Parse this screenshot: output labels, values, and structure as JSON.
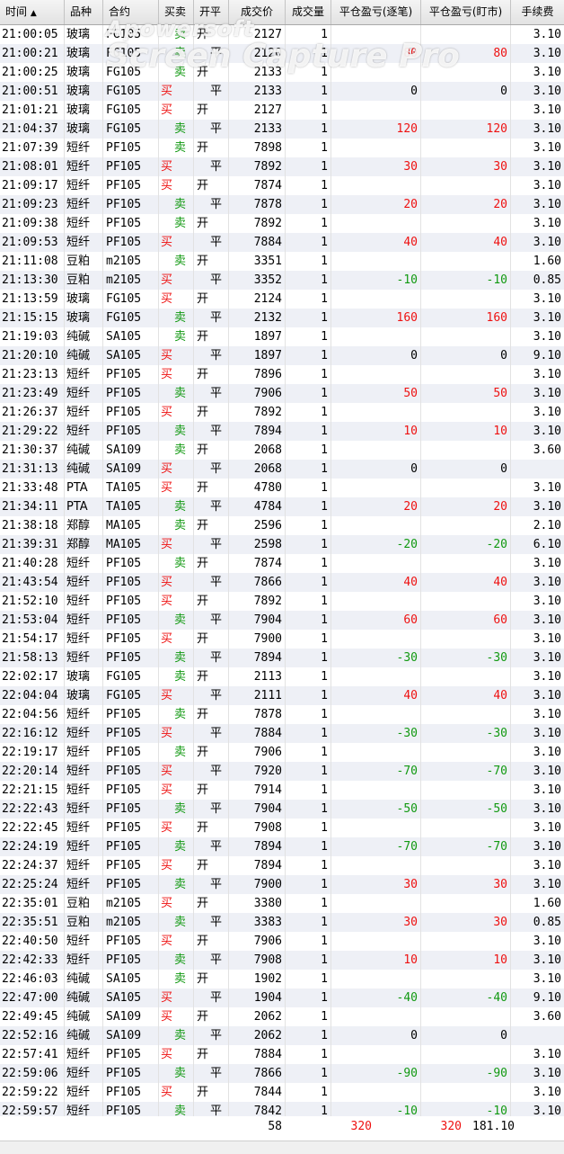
{
  "headers": {
    "time": "时间",
    "sort_arrow": "▲",
    "name": "品种",
    "code": "合约",
    "bs": "买卖",
    "oc": "开平",
    "price": "成交价",
    "qty": "成交量",
    "pl_close": "平仓盈亏(逐笔)",
    "pl_mark": "平仓盈亏(盯市)",
    "fee": "手续费"
  },
  "rows": [
    {
      "time": "21:00:05",
      "name": "玻璃",
      "code": "FG105",
      "bs": "卖",
      "oc": "开",
      "price": "2127",
      "qty": "1",
      "pl1": "",
      "pl2": "",
      "fee": "3.10"
    },
    {
      "time": "21:00:21",
      "name": "玻璃",
      "code": "FG105",
      "bs": "卖",
      "oc": "平",
      "price": "2120",
      "qty": "1",
      "pl1": "80",
      "pl2": "80",
      "fee": "3.10"
    },
    {
      "time": "21:00:25",
      "name": "玻璃",
      "code": "FG105",
      "bs": "卖",
      "oc": "开",
      "price": "2133",
      "qty": "1",
      "pl1": "",
      "pl2": "",
      "fee": "3.10"
    },
    {
      "time": "21:00:51",
      "name": "玻璃",
      "code": "FG105",
      "bs": "买",
      "oc": "平",
      "price": "2133",
      "qty": "1",
      "pl1": "0",
      "pl2": "0",
      "fee": "3.10"
    },
    {
      "time": "21:01:21",
      "name": "玻璃",
      "code": "FG105",
      "bs": "买",
      "oc": "开",
      "price": "2127",
      "qty": "1",
      "pl1": "",
      "pl2": "",
      "fee": "3.10"
    },
    {
      "time": "21:04:37",
      "name": "玻璃",
      "code": "FG105",
      "bs": "卖",
      "oc": "平",
      "price": "2133",
      "qty": "1",
      "pl1": "120",
      "pl2": "120",
      "fee": "3.10"
    },
    {
      "time": "21:07:39",
      "name": "短纤",
      "code": "PF105",
      "bs": "卖",
      "oc": "开",
      "price": "7898",
      "qty": "1",
      "pl1": "",
      "pl2": "",
      "fee": "3.10"
    },
    {
      "time": "21:08:01",
      "name": "短纤",
      "code": "PF105",
      "bs": "买",
      "oc": "平",
      "price": "7892",
      "qty": "1",
      "pl1": "30",
      "pl2": "30",
      "fee": "3.10"
    },
    {
      "time": "21:09:17",
      "name": "短纤",
      "code": "PF105",
      "bs": "买",
      "oc": "开",
      "price": "7874",
      "qty": "1",
      "pl1": "",
      "pl2": "",
      "fee": "3.10"
    },
    {
      "time": "21:09:23",
      "name": "短纤",
      "code": "PF105",
      "bs": "卖",
      "oc": "平",
      "price": "7878",
      "qty": "1",
      "pl1": "20",
      "pl2": "20",
      "fee": "3.10"
    },
    {
      "time": "21:09:38",
      "name": "短纤",
      "code": "PF105",
      "bs": "卖",
      "oc": "开",
      "price": "7892",
      "qty": "1",
      "pl1": "",
      "pl2": "",
      "fee": "3.10"
    },
    {
      "time": "21:09:53",
      "name": "短纤",
      "code": "PF105",
      "bs": "买",
      "oc": "平",
      "price": "7884",
      "qty": "1",
      "pl1": "40",
      "pl2": "40",
      "fee": "3.10"
    },
    {
      "time": "21:11:08",
      "name": "豆粕",
      "code": "m2105",
      "bs": "卖",
      "oc": "开",
      "price": "3351",
      "qty": "1",
      "pl1": "",
      "pl2": "",
      "fee": "1.60"
    },
    {
      "time": "21:13:30",
      "name": "豆粕",
      "code": "m2105",
      "bs": "买",
      "oc": "平",
      "price": "3352",
      "qty": "1",
      "pl1": "-10",
      "pl2": "-10",
      "fee": "0.85"
    },
    {
      "time": "21:13:59",
      "name": "玻璃",
      "code": "FG105",
      "bs": "买",
      "oc": "开",
      "price": "2124",
      "qty": "1",
      "pl1": "",
      "pl2": "",
      "fee": "3.10"
    },
    {
      "time": "21:15:15",
      "name": "玻璃",
      "code": "FG105",
      "bs": "卖",
      "oc": "平",
      "price": "2132",
      "qty": "1",
      "pl1": "160",
      "pl2": "160",
      "fee": "3.10"
    },
    {
      "time": "21:19:03",
      "name": "纯碱",
      "code": "SA105",
      "bs": "卖",
      "oc": "开",
      "price": "1897",
      "qty": "1",
      "pl1": "",
      "pl2": "",
      "fee": "3.10"
    },
    {
      "time": "21:20:10",
      "name": "纯碱",
      "code": "SA105",
      "bs": "买",
      "oc": "平",
      "price": "1897",
      "qty": "1",
      "pl1": "0",
      "pl2": "0",
      "fee": "9.10"
    },
    {
      "time": "21:23:13",
      "name": "短纤",
      "code": "PF105",
      "bs": "买",
      "oc": "开",
      "price": "7896",
      "qty": "1",
      "pl1": "",
      "pl2": "",
      "fee": "3.10"
    },
    {
      "time": "21:23:49",
      "name": "短纤",
      "code": "PF105",
      "bs": "卖",
      "oc": "平",
      "price": "7906",
      "qty": "1",
      "pl1": "50",
      "pl2": "50",
      "fee": "3.10"
    },
    {
      "time": "21:26:37",
      "name": "短纤",
      "code": "PF105",
      "bs": "买",
      "oc": "开",
      "price": "7892",
      "qty": "1",
      "pl1": "",
      "pl2": "",
      "fee": "3.10"
    },
    {
      "time": "21:29:22",
      "name": "短纤",
      "code": "PF105",
      "bs": "卖",
      "oc": "平",
      "price": "7894",
      "qty": "1",
      "pl1": "10",
      "pl2": "10",
      "fee": "3.10"
    },
    {
      "time": "21:30:37",
      "name": "纯碱",
      "code": "SA109",
      "bs": "卖",
      "oc": "开",
      "price": "2068",
      "qty": "1",
      "pl1": "",
      "pl2": "",
      "fee": "3.60"
    },
    {
      "time": "21:31:13",
      "name": "纯碱",
      "code": "SA109",
      "bs": "买",
      "oc": "平",
      "price": "2068",
      "qty": "1",
      "pl1": "0",
      "pl2": "0",
      "fee": ""
    },
    {
      "time": "21:33:48",
      "name": "PTA",
      "code": "TA105",
      "bs": "买",
      "oc": "开",
      "price": "4780",
      "qty": "1",
      "pl1": "",
      "pl2": "",
      "fee": "3.10"
    },
    {
      "time": "21:34:11",
      "name": "PTA",
      "code": "TA105",
      "bs": "卖",
      "oc": "平",
      "price": "4784",
      "qty": "1",
      "pl1": "20",
      "pl2": "20",
      "fee": "3.10"
    },
    {
      "time": "21:38:18",
      "name": "郑醇",
      "code": "MA105",
      "bs": "卖",
      "oc": "开",
      "price": "2596",
      "qty": "1",
      "pl1": "",
      "pl2": "",
      "fee": "2.10"
    },
    {
      "time": "21:39:31",
      "name": "郑醇",
      "code": "MA105",
      "bs": "买",
      "oc": "平",
      "price": "2598",
      "qty": "1",
      "pl1": "-20",
      "pl2": "-20",
      "fee": "6.10"
    },
    {
      "time": "21:40:28",
      "name": "短纤",
      "code": "PF105",
      "bs": "卖",
      "oc": "开",
      "price": "7874",
      "qty": "1",
      "pl1": "",
      "pl2": "",
      "fee": "3.10"
    },
    {
      "time": "21:43:54",
      "name": "短纤",
      "code": "PF105",
      "bs": "买",
      "oc": "平",
      "price": "7866",
      "qty": "1",
      "pl1": "40",
      "pl2": "40",
      "fee": "3.10"
    },
    {
      "time": "21:52:10",
      "name": "短纤",
      "code": "PF105",
      "bs": "买",
      "oc": "开",
      "price": "7892",
      "qty": "1",
      "pl1": "",
      "pl2": "",
      "fee": "3.10"
    },
    {
      "time": "21:53:04",
      "name": "短纤",
      "code": "PF105",
      "bs": "卖",
      "oc": "平",
      "price": "7904",
      "qty": "1",
      "pl1": "60",
      "pl2": "60",
      "fee": "3.10"
    },
    {
      "time": "21:54:17",
      "name": "短纤",
      "code": "PF105",
      "bs": "买",
      "oc": "开",
      "price": "7900",
      "qty": "1",
      "pl1": "",
      "pl2": "",
      "fee": "3.10"
    },
    {
      "time": "21:58:13",
      "name": "短纤",
      "code": "PF105",
      "bs": "卖",
      "oc": "平",
      "price": "7894",
      "qty": "1",
      "pl1": "-30",
      "pl2": "-30",
      "fee": "3.10"
    },
    {
      "time": "22:02:17",
      "name": "玻璃",
      "code": "FG105",
      "bs": "卖",
      "oc": "开",
      "price": "2113",
      "qty": "1",
      "pl1": "",
      "pl2": "",
      "fee": "3.10"
    },
    {
      "time": "22:04:04",
      "name": "玻璃",
      "code": "FG105",
      "bs": "买",
      "oc": "平",
      "price": "2111",
      "qty": "1",
      "pl1": "40",
      "pl2": "40",
      "fee": "3.10"
    },
    {
      "time": "22:04:56",
      "name": "短纤",
      "code": "PF105",
      "bs": "卖",
      "oc": "开",
      "price": "7878",
      "qty": "1",
      "pl1": "",
      "pl2": "",
      "fee": "3.10"
    },
    {
      "time": "22:16:12",
      "name": "短纤",
      "code": "PF105",
      "bs": "买",
      "oc": "平",
      "price": "7884",
      "qty": "1",
      "pl1": "-30",
      "pl2": "-30",
      "fee": "3.10"
    },
    {
      "time": "22:19:17",
      "name": "短纤",
      "code": "PF105",
      "bs": "卖",
      "oc": "开",
      "price": "7906",
      "qty": "1",
      "pl1": "",
      "pl2": "",
      "fee": "3.10"
    },
    {
      "time": "22:20:14",
      "name": "短纤",
      "code": "PF105",
      "bs": "买",
      "oc": "平",
      "price": "7920",
      "qty": "1",
      "pl1": "-70",
      "pl2": "-70",
      "fee": "3.10"
    },
    {
      "time": "22:21:15",
      "name": "短纤",
      "code": "PF105",
      "bs": "买",
      "oc": "开",
      "price": "7914",
      "qty": "1",
      "pl1": "",
      "pl2": "",
      "fee": "3.10"
    },
    {
      "time": "22:22:43",
      "name": "短纤",
      "code": "PF105",
      "bs": "卖",
      "oc": "平",
      "price": "7904",
      "qty": "1",
      "pl1": "-50",
      "pl2": "-50",
      "fee": "3.10"
    },
    {
      "time": "22:22:45",
      "name": "短纤",
      "code": "PF105",
      "bs": "买",
      "oc": "开",
      "price": "7908",
      "qty": "1",
      "pl1": "",
      "pl2": "",
      "fee": "3.10"
    },
    {
      "time": "22:24:19",
      "name": "短纤",
      "code": "PF105",
      "bs": "卖",
      "oc": "平",
      "price": "7894",
      "qty": "1",
      "pl1": "-70",
      "pl2": "-70",
      "fee": "3.10"
    },
    {
      "time": "22:24:37",
      "name": "短纤",
      "code": "PF105",
      "bs": "买",
      "oc": "开",
      "price": "7894",
      "qty": "1",
      "pl1": "",
      "pl2": "",
      "fee": "3.10"
    },
    {
      "time": "22:25:24",
      "name": "短纤",
      "code": "PF105",
      "bs": "卖",
      "oc": "平",
      "price": "7900",
      "qty": "1",
      "pl1": "30",
      "pl2": "30",
      "fee": "3.10"
    },
    {
      "time": "22:35:01",
      "name": "豆粕",
      "code": "m2105",
      "bs": "买",
      "oc": "开",
      "price": "3380",
      "qty": "1",
      "pl1": "",
      "pl2": "",
      "fee": "1.60"
    },
    {
      "time": "22:35:51",
      "name": "豆粕",
      "code": "m2105",
      "bs": "卖",
      "oc": "平",
      "price": "3383",
      "qty": "1",
      "pl1": "30",
      "pl2": "30",
      "fee": "0.85"
    },
    {
      "time": "22:40:50",
      "name": "短纤",
      "code": "PF105",
      "bs": "买",
      "oc": "开",
      "price": "7906",
      "qty": "1",
      "pl1": "",
      "pl2": "",
      "fee": "3.10"
    },
    {
      "time": "22:42:33",
      "name": "短纤",
      "code": "PF105",
      "bs": "卖",
      "oc": "平",
      "price": "7908",
      "qty": "1",
      "pl1": "10",
      "pl2": "10",
      "fee": "3.10"
    },
    {
      "time": "22:46:03",
      "name": "纯碱",
      "code": "SA105",
      "bs": "卖",
      "oc": "开",
      "price": "1902",
      "qty": "1",
      "pl1": "",
      "pl2": "",
      "fee": "3.10"
    },
    {
      "time": "22:47:00",
      "name": "纯碱",
      "code": "SA105",
      "bs": "买",
      "oc": "平",
      "price": "1904",
      "qty": "1",
      "pl1": "-40",
      "pl2": "-40",
      "fee": "9.10"
    },
    {
      "time": "22:49:45",
      "name": "纯碱",
      "code": "SA109",
      "bs": "买",
      "oc": "开",
      "price": "2062",
      "qty": "1",
      "pl1": "",
      "pl2": "",
      "fee": "3.60"
    },
    {
      "time": "22:52:16",
      "name": "纯碱",
      "code": "SA109",
      "bs": "卖",
      "oc": "平",
      "price": "2062",
      "qty": "1",
      "pl1": "0",
      "pl2": "0",
      "fee": ""
    },
    {
      "time": "22:57:41",
      "name": "短纤",
      "code": "PF105",
      "bs": "买",
      "oc": "开",
      "price": "7884",
      "qty": "1",
      "pl1": "",
      "pl2": "",
      "fee": "3.10"
    },
    {
      "time": "22:59:06",
      "name": "短纤",
      "code": "PF105",
      "bs": "卖",
      "oc": "平",
      "price": "7866",
      "qty": "1",
      "pl1": "-90",
      "pl2": "-90",
      "fee": "3.10"
    },
    {
      "time": "22:59:22",
      "name": "短纤",
      "code": "PF105",
      "bs": "买",
      "oc": "开",
      "price": "7844",
      "qty": "1",
      "pl1": "",
      "pl2": "",
      "fee": "3.10"
    },
    {
      "time": "22:59:57",
      "name": "短纤",
      "code": "PF105",
      "bs": "卖",
      "oc": "平",
      "price": "7842",
      "qty": "1",
      "pl1": "-10",
      "pl2": "-10",
      "fee": "3.10"
    }
  ],
  "totals": {
    "qty": "58",
    "pl1": "320",
    "pl2": "320",
    "fee": "181.10"
  },
  "watermark": {
    "line1": "Apowersoft",
    "line2": "Screen Capture Pro"
  },
  "colors": {
    "buy": "#ee1111",
    "sell": "#119911",
    "profit": "#ee1111",
    "loss": "#119911"
  }
}
